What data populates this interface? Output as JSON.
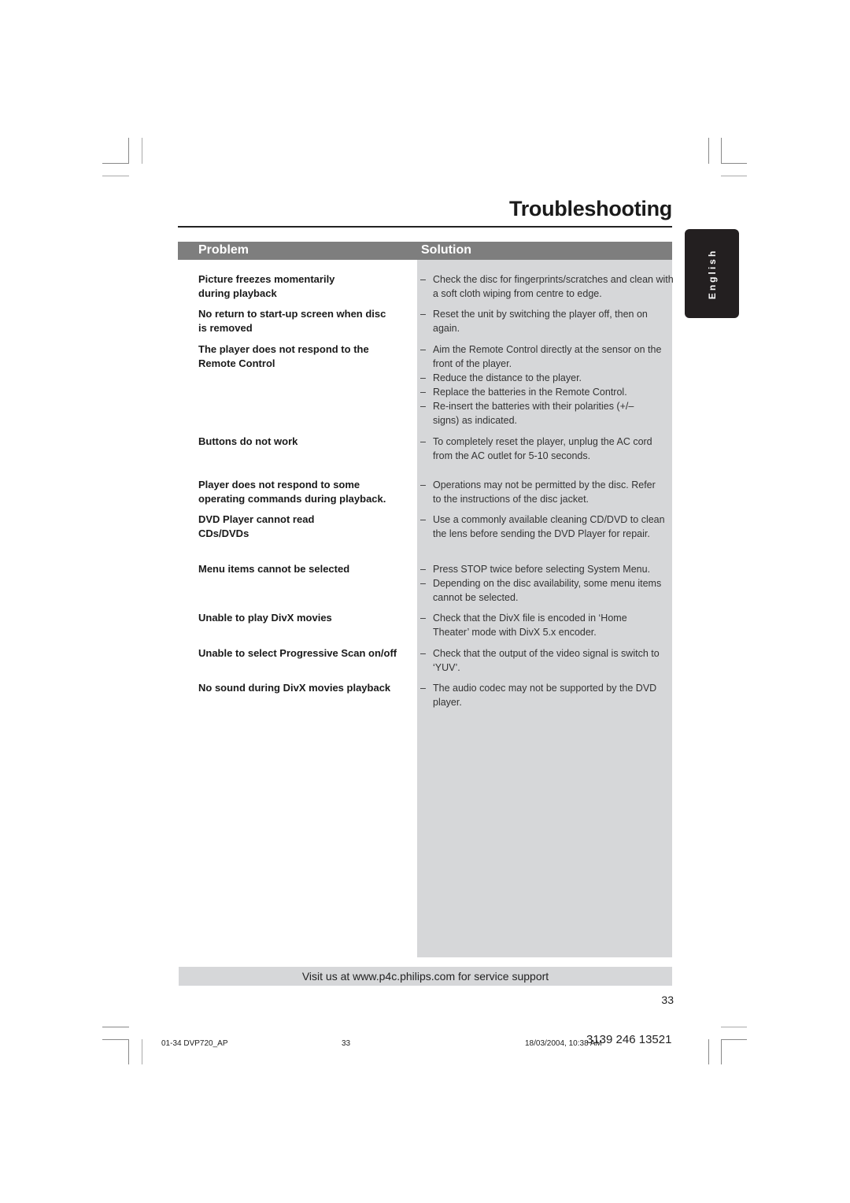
{
  "page": {
    "title": "Troubleshooting",
    "language_tab": "English",
    "page_number": "33"
  },
  "table": {
    "headers": {
      "problem": "Problem",
      "solution": "Solution"
    },
    "rows": [
      {
        "problem": "Picture freezes momentarily during playback",
        "solutions": [
          "Check the disc for fingerprints/scratches and clean with a soft cloth wiping from centre to edge."
        ]
      },
      {
        "problem": "No return to start-up screen when disc is removed",
        "solutions": [
          "Reset the unit by switching the player off, then on again."
        ]
      },
      {
        "problem": "The player does not respond to the Remote Control",
        "solutions": [
          "Aim the Remote Control directly at the sensor on the front of the player.",
          "Reduce the distance to the player.",
          "Replace the batteries in the Remote Control.",
          "Re-insert the batteries with their polarities (+/– signs) as indicated."
        ]
      },
      {
        "problem": "Buttons do not work",
        "solutions": [
          "To completely reset the player, unplug the AC cord from the AC outlet for 5-10 seconds."
        ]
      },
      {
        "problem": "Player does not respond to some operating commands during playback.",
        "solutions": [
          "Operations may not be permitted by the disc. Refer to the instructions of  the disc jacket."
        ]
      },
      {
        "problem": "DVD Player cannot read CDs/DVDs",
        "solutions": [
          "Use a commonly available cleaning CD/DVD to clean the lens before sending the DVD Player for repair."
        ]
      },
      {
        "problem": "Menu items cannot be selected",
        "solutions": [
          "Press STOP twice before selecting System Menu.",
          "Depending on the disc availability, some menu items cannot be selected."
        ]
      },
      {
        "problem": "Unable to play DivX movies",
        "solutions": [
          "Check that the DivX file is encoded in ‘Home Theater’ mode with DivX 5.x encoder."
        ]
      },
      {
        "problem": "Unable to select Progressive Scan on/off",
        "solutions": [
          "Check that the output of the video signal is switch to ‘YUV’."
        ]
      },
      {
        "problem": "No sound during DivX movies playback",
        "solutions": [
          "The audio codec may not be supported by the DVD player."
        ]
      }
    ]
  },
  "footer": {
    "service_text": "Visit us at www.p4c.philips.com for service support",
    "slug_file": "01-34 DVP720_AP",
    "slug_page": "33",
    "slug_datetime": "18/03/2004, 10:38 AM",
    "product_code": "3139 246 13521"
  },
  "colors": {
    "header_bar": "#7e7e7e",
    "solution_background": "#d6d7d9",
    "language_tab": "#231f20"
  }
}
